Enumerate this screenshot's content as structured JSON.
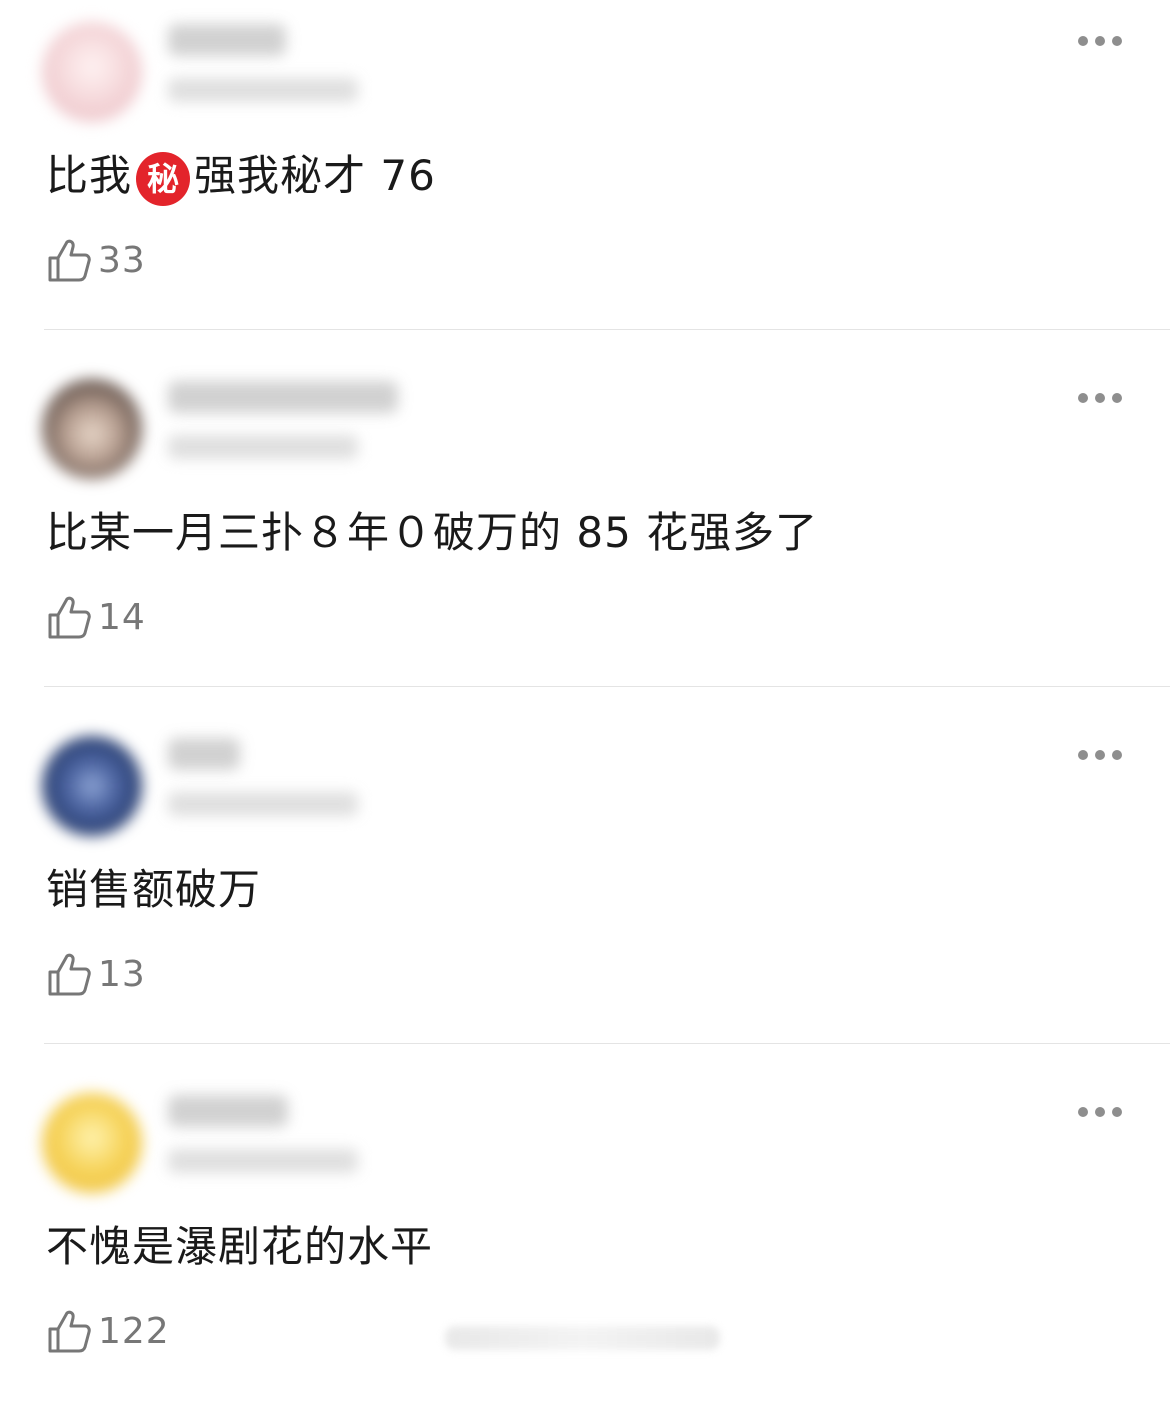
{
  "comments": [
    {
      "text_before_badge": "比我",
      "badge": "秘",
      "text_after_badge": "强我秘才 76",
      "likes": "33",
      "avatar_color": "#f3d3d6"
    },
    {
      "text": "比某一月三扑８年０破万的 85 花强多了",
      "likes": "14",
      "avatar_color": "#6b5a52"
    },
    {
      "text": "销售额破万",
      "likes": "13",
      "avatar_color": "#2e4477"
    },
    {
      "text": "不愧是瀑剧花的水平",
      "likes": "122",
      "avatar_color": "#f2c94c"
    }
  ],
  "icons": {
    "more": "more-options-icon",
    "like": "thumbs-up-icon"
  },
  "colors": {
    "badge": "#e3242b",
    "like_count": "#777777",
    "divider": "#e4e4e4"
  }
}
